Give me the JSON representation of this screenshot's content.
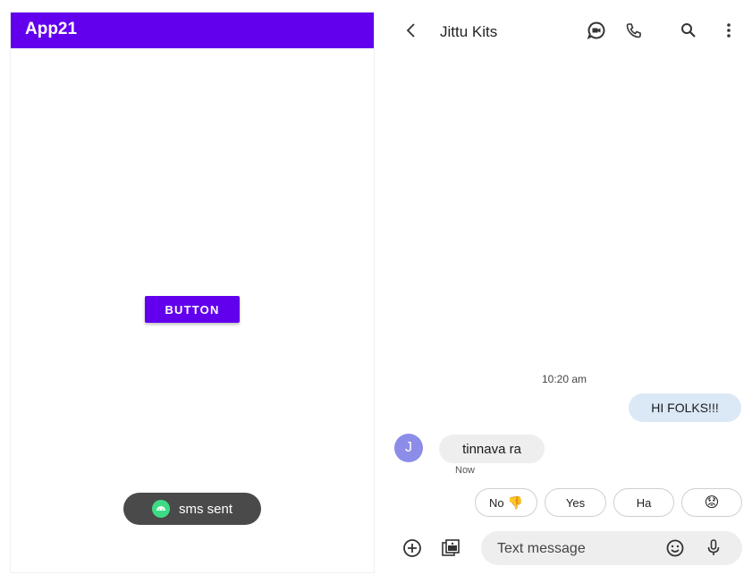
{
  "left_app": {
    "title": "App21",
    "button_label": "BUTTON",
    "toast_text": "sms sent",
    "colors": {
      "primary": "#6200ee",
      "toast": "#4a4a4a",
      "android_green": "#3ddc84"
    }
  },
  "messages_app": {
    "header": {
      "back_icon": "back-arrow-icon",
      "contact_name": "Jittu Kits",
      "actions": [
        "video-chat-icon",
        "phone-icon",
        "search-icon",
        "more-vert-icon"
      ]
    },
    "conversation": {
      "timestamp": "10:20 am",
      "sent_message": "HI FOLKS!!!",
      "received": {
        "avatar_initial": "J",
        "text": "tinnava ra",
        "time": "Now"
      }
    },
    "smart_replies": [
      {
        "label": "No",
        "emoji": "👎"
      },
      {
        "label": "Yes"
      },
      {
        "label": "Ha"
      },
      {
        "label": "",
        "emoji": "😟"
      }
    ],
    "compose": {
      "placeholder": "Text message",
      "add_icon": "add-circle-icon",
      "gallery_icon": "gallery-icon",
      "emoji_icon": "emoji-icon",
      "mic_icon": "mic-icon"
    },
    "colors": {
      "sent_bubble": "#dbe8f6",
      "received_bubble": "#eeeeee",
      "avatar": "#8c8de8"
    }
  }
}
